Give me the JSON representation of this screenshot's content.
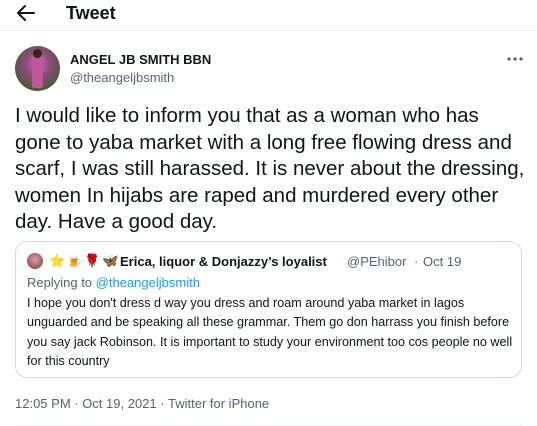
{
  "header": {
    "title": "Tweet",
    "back_icon": "arrow-left-icon"
  },
  "author": {
    "name": "ANGEL JB SMITH BBN",
    "handle": "@theangeljbsmith"
  },
  "tweet": {
    "text": "I would like to inform you that as a woman who has gone to yaba market with a long free flowing dress and scarf, I was still harassed. It is never about the dressing, women In hijabs are raped and murdered every other day. Have a good day.",
    "timestamp": "12:05 PM · Oct 19, 2021",
    "separator": "·",
    "source": "Twitter for iPhone"
  },
  "quoted_tweet": {
    "emojis": [
      "⭐",
      "🍺",
      "🌹",
      "🦋"
    ],
    "name": "Erica, liquor & Donjazzy’s loyalist",
    "handle": "@PEhibor",
    "separator": "·",
    "date": "Oct 19",
    "replying_prefix": "Replying to",
    "replying_to": "@theangeljbsmith",
    "text": "I hope you don't dress d way you dress and roam around yaba market in lagos unguarded and be speaking all these grammar. Them go don harrass you finish before you say jack Robinson. It is important to study your environment too cos people no well for this country"
  },
  "colors": {
    "text_primary": "#0f1419",
    "text_secondary": "#536471",
    "link": "#1d9bf0",
    "border": "#cfd9de"
  }
}
